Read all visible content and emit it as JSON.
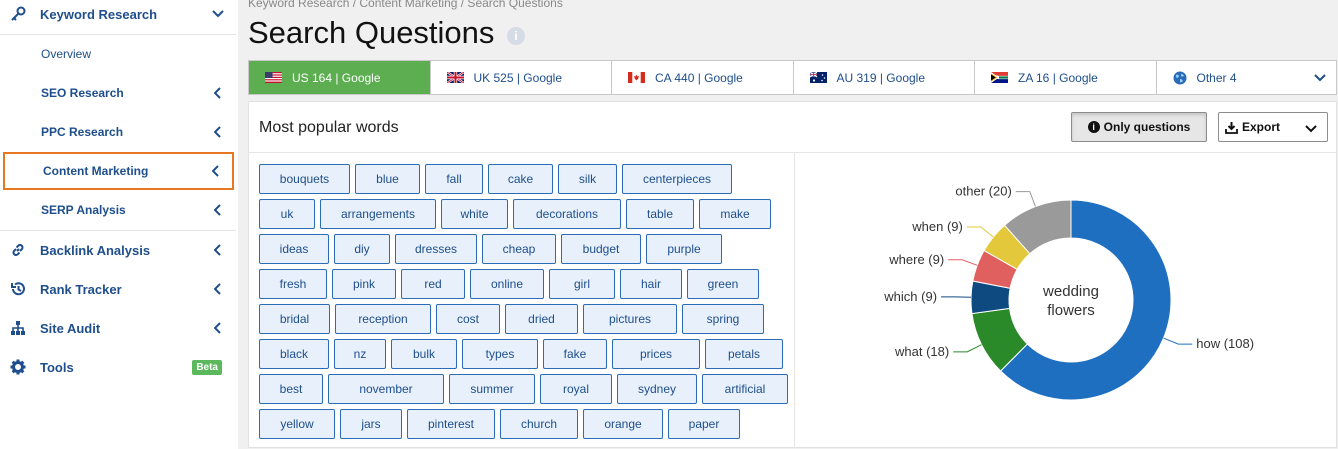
{
  "sidebar": {
    "keyword_research": "Keyword Research",
    "overview": "Overview",
    "seo_research": "SEO Research",
    "ppc_research": "PPC Research",
    "content_marketing": "Content Marketing",
    "serp_analysis": "SERP Analysis",
    "backlink_analysis": "Backlink Analysis",
    "rank_tracker": "Rank Tracker",
    "site_audit": "Site Audit",
    "tools": "Tools",
    "tools_badge": "Beta"
  },
  "header": {
    "breadcrumb": "Keyword Research / Content Marketing / Search Questions",
    "title": "Search Questions",
    "info_glyph": "i"
  },
  "tabs": [
    {
      "label": "US 164 | Google",
      "flag": "us-flag-icon"
    },
    {
      "label": "UK 525 | Google",
      "flag": "uk-flag-icon"
    },
    {
      "label": "CA 440 | Google",
      "flag": "ca-flag-icon"
    },
    {
      "label": "AU 319 | Google",
      "flag": "au-flag-icon"
    },
    {
      "label": "ZA 16 | Google",
      "flag": "za-flag-icon"
    },
    {
      "label": "Other 4",
      "flag": "globe-icon"
    }
  ],
  "card": {
    "title": "Most popular words",
    "only_questions": "Only questions",
    "export": "Export"
  },
  "words": [
    [
      "bouquets",
      "blue",
      "fall",
      "cake",
      "silk",
      "centerpieces"
    ],
    [
      "uk",
      "arrangements",
      "white",
      "decorations",
      "table",
      "make"
    ],
    [
      "ideas",
      "diy",
      "dresses",
      "cheap",
      "budget",
      "purple"
    ],
    [
      "fresh",
      "pink",
      "red",
      "online",
      "girl",
      "hair",
      "green"
    ],
    [
      "bridal",
      "reception",
      "cost",
      "dried",
      "pictures",
      "spring"
    ],
    [
      "black",
      "nz",
      "bulk",
      "types",
      "fake",
      "prices",
      "petals"
    ],
    [
      "best",
      "november",
      "summer",
      "royal",
      "sydney",
      "artificial"
    ],
    [
      "yellow",
      "jars",
      "pinterest",
      "church",
      "orange",
      "paper"
    ]
  ],
  "chart_data": {
    "type": "pie",
    "title": "wedding flowers",
    "title_lines": [
      "wedding",
      "flowers"
    ],
    "series": [
      {
        "name": "how",
        "value": 108,
        "label": "how (108)",
        "color": "#1f6fc0"
      },
      {
        "name": "what",
        "value": 18,
        "label": "what (18)",
        "color": "#2a8a2a"
      },
      {
        "name": "which",
        "value": 9,
        "label": "which (9)",
        "color": "#0e4a80"
      },
      {
        "name": "where",
        "value": 9,
        "label": "where (9)",
        "color": "#e06060"
      },
      {
        "name": "when",
        "value": 9,
        "label": "when (9)",
        "color": "#e2c83a"
      },
      {
        "name": "other",
        "value": 20,
        "label": "other (20)",
        "color": "#9a9a9a"
      }
    ]
  },
  "colors": {
    "accent_blue": "#1e4e8c",
    "active_tab": "#5cae50",
    "active_nav_border": "#e87722"
  }
}
